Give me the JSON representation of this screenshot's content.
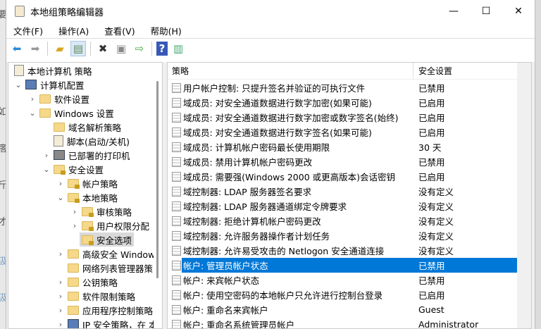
{
  "window": {
    "title": "本地组策略编辑器",
    "minimize": "—",
    "maximize": "☐",
    "close": "✕"
  },
  "background_fragments": [
    "要",
    "如",
    "瘩",
    "斤",
    "才",
    "汲",
    "汲"
  ],
  "menu": [
    "文件(F)",
    "操作(A)",
    "查看(V)",
    "帮助(H)"
  ],
  "toolbar": [
    "back-icon",
    "forward-icon",
    "up-folder-icon",
    "show-hide-tree-icon",
    "delete-icon",
    "properties-icon",
    "export-list-icon",
    "help-icon",
    "extended-view-icon"
  ],
  "tree": [
    "本地计算机 策略",
    "计算机配置",
    "软件设置",
    "Windows 设置",
    "域名解析策略",
    "脚本(启动/关机)",
    "已部署的打印机",
    "安全设置",
    "帐户策略",
    "本地策略",
    "审核策略",
    "用户权限分配",
    "安全选项",
    "高级安全 Window",
    "网络列表管理器策!",
    "公钥策略",
    "软件限制策略",
    "应用程序控制策略",
    "IP 安全策略，在 本"
  ],
  "list": {
    "columns": [
      "策略",
      "安全设置"
    ],
    "selected_index": 12,
    "rows": [
      {
        "name": "用户帐户控制: 只提升签名并验证的可执行文件",
        "value": "已禁用"
      },
      {
        "name": "域成员: 对安全通道数据进行数字加密(如果可能)",
        "value": "已启用"
      },
      {
        "name": "域成员: 对安全通道数据进行数字加密或数字签名(始终)",
        "value": "已启用"
      },
      {
        "name": "域成员: 对安全通道数据进行数字签名(如果可能)",
        "value": "已启用"
      },
      {
        "name": "域成员: 计算机帐户密码最长使用期限",
        "value": "30 天"
      },
      {
        "name": "域成员: 禁用计算机帐户密码更改",
        "value": "已禁用"
      },
      {
        "name": "域成员: 需要强(Windows 2000 或更高版本)会话密钥",
        "value": "已启用"
      },
      {
        "name": "域控制器: LDAP 服务器签名要求",
        "value": "没有定义"
      },
      {
        "name": "域控制器: LDAP 服务器通道绑定令牌要求",
        "value": "没有定义"
      },
      {
        "name": "域控制器: 拒绝计算机帐户密码更改",
        "value": "没有定义"
      },
      {
        "name": "域控制器: 允许服务器操作者计划任务",
        "value": "没有定义"
      },
      {
        "name": "域控制器: 允许易受攻击的 Netlogon 安全通道连接",
        "value": "没有定义"
      },
      {
        "name": "帐户: 管理员帐户状态",
        "value": "已禁用"
      },
      {
        "name": "帐户: 来宾帐户状态",
        "value": "已禁用"
      },
      {
        "name": "帐户: 使用空密码的本地帐户只允许进行控制台登录",
        "value": "已启用"
      },
      {
        "name": "帐户: 重命名来宾帐户",
        "value": "Guest"
      },
      {
        "name": "帐户: 重命名系统管理员帐户",
        "value": "Administrator"
      }
    ]
  }
}
